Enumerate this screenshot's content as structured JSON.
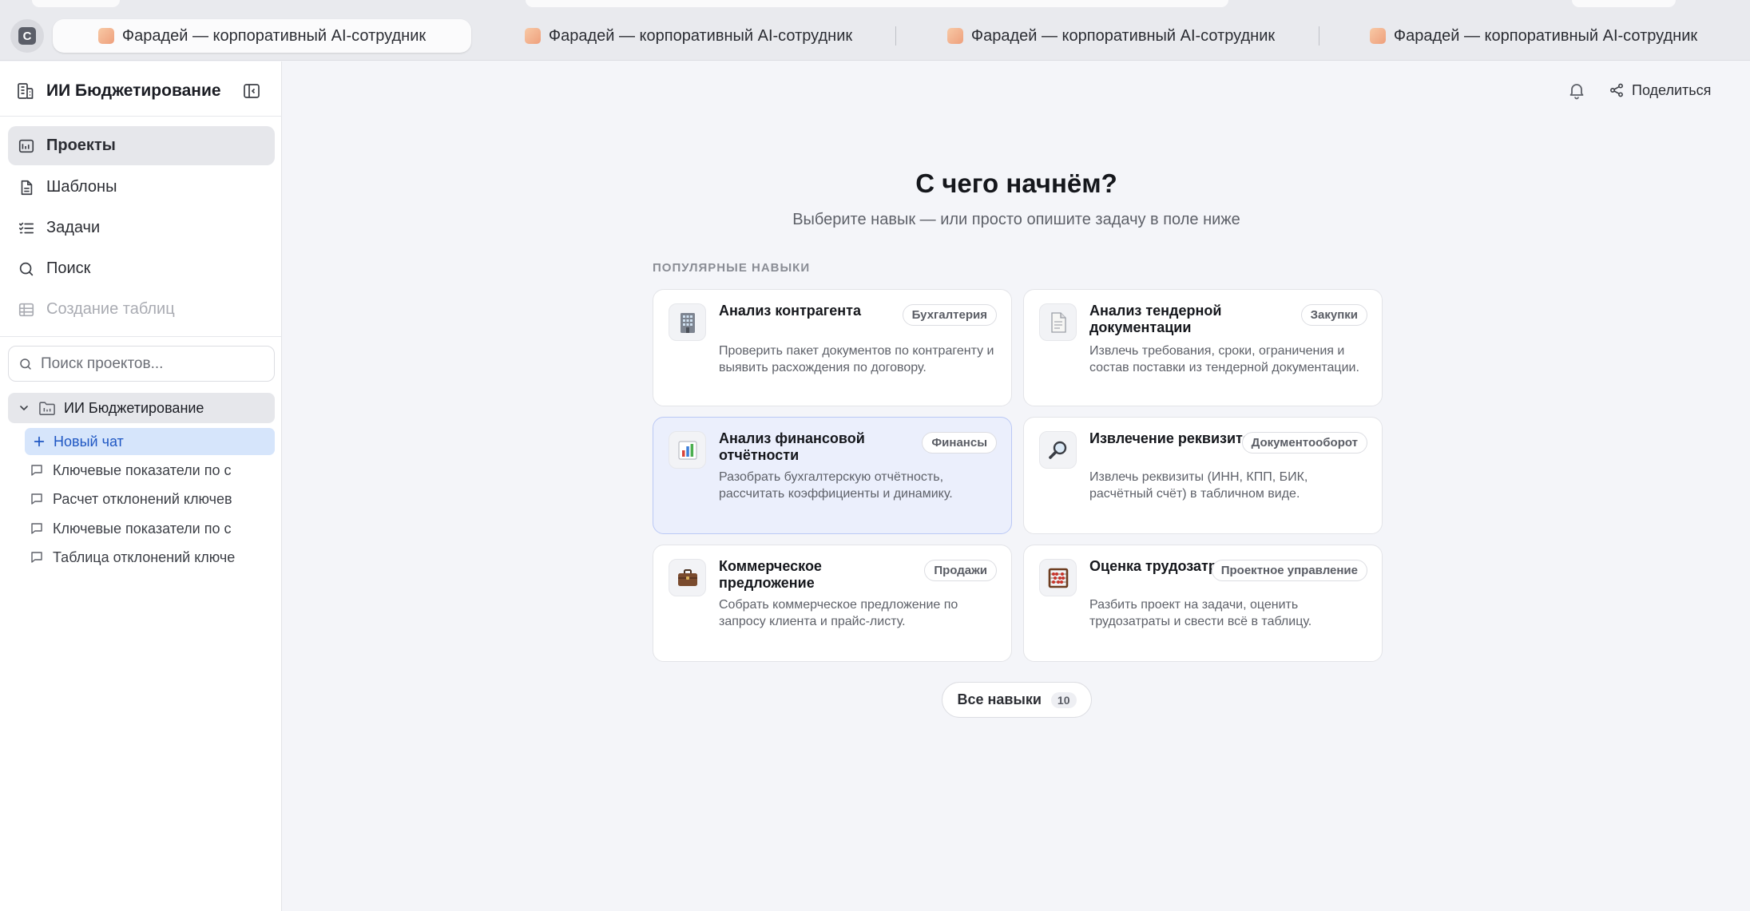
{
  "tabs": [
    {
      "title": "Фарадей — корпоративный AI-сотрудник",
      "active": true
    },
    {
      "title": "Фарадей — корпоративный AI-сотрудник",
      "active": false
    },
    {
      "title": "Фарадей — корпоративный AI-сотрудник",
      "active": false
    },
    {
      "title": "Фарадей — корпоративный AI-сотрудник",
      "active": false
    }
  ],
  "profile_initial": "C",
  "sidebar": {
    "workspace_title": "ИИ Бюджетирование",
    "nav": [
      {
        "label": "Проекты",
        "icon": "projects-icon",
        "active": true
      },
      {
        "label": "Шаблоны",
        "icon": "document-icon"
      },
      {
        "label": "Задачи",
        "icon": "tasks-icon"
      },
      {
        "label": "Поиск",
        "icon": "search-icon"
      },
      {
        "label": "Создание таблиц",
        "icon": "table-icon",
        "disabled": true
      }
    ],
    "search_placeholder": "Поиск проектов...",
    "folder": "ИИ Бюджетирование",
    "new_chat": "Новый чат",
    "chats": [
      "Ключевые показатели по с",
      "Расчет отклонений ключев",
      "Ключевые показатели по с",
      "Таблица отклонений ключе"
    ]
  },
  "header": {
    "share_label": "Поделиться"
  },
  "hero": {
    "title": "С чего начнём?",
    "subtitle": "Выберите навык — или просто опишите задачу в поле ниже"
  },
  "skills": {
    "section_label": "ПОПУЛЯРНЫЕ НАВЫКИ",
    "cards": [
      {
        "title": "Анализ контрагента",
        "badge": "Бухгалтерия",
        "desc": "Проверить пакет документов по контрагенту и выявить расхождения по договору.",
        "icon": "office-building-icon"
      },
      {
        "title": "Анализ тендерной документации",
        "badge": "Закупки",
        "desc": "Извлечь требования, сроки, ограничения и состав поставки из тендерной документации.",
        "icon": "document-page-icon"
      },
      {
        "title": "Анализ финансовой отчётности",
        "badge": "Финансы",
        "desc": "Разобрать бухгалтерскую отчётность, рассчитать коэффициенты и динамику.",
        "icon": "bar-chart-icon",
        "selected": true
      },
      {
        "title": "Извлечение реквизитов",
        "badge": "Документооборот",
        "desc": "Извлечь реквизиты (ИНН, КПП, БИК, расчётный счёт) в табличном виде.",
        "icon": "magnifier-icon"
      },
      {
        "title": "Коммерческое предложение",
        "badge": "Продажи",
        "desc": "Собрать коммерческое предложение по запросу клиента и прайс-листу.",
        "icon": "briefcase-icon"
      },
      {
        "title": "Оценка трудозатрат",
        "badge": "Проектное управление",
        "desc": "Разбить проект на задачи, оценить трудозатраты и свести всё в таблицу.",
        "icon": "abacus-icon"
      }
    ],
    "all_label": "Все навыки",
    "all_count": "10"
  }
}
